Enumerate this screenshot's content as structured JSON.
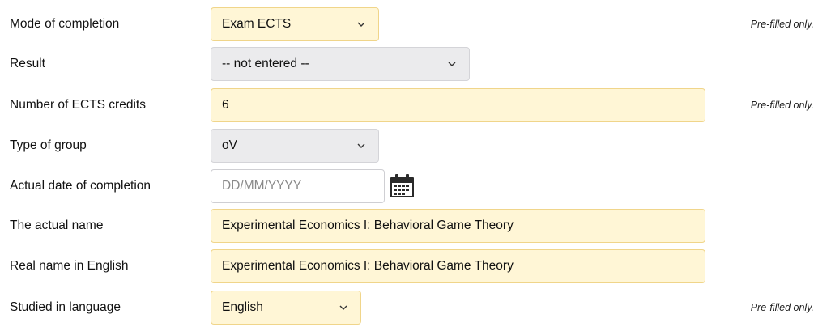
{
  "rows": {
    "mode": {
      "label": "Mode of completion",
      "value": "Exam ECTS",
      "note": "Pre-filled only."
    },
    "result": {
      "label": "Result",
      "value": "-- not entered --"
    },
    "credits": {
      "label": "Number of ECTS credits",
      "value": "6",
      "note": "Pre-filled only."
    },
    "group": {
      "label": "Type of group",
      "value": "oV"
    },
    "date": {
      "label": "Actual date of completion",
      "placeholder": "DD/MM/YYYY",
      "icon": "calendar-icon"
    },
    "actual_name": {
      "label": "The actual name",
      "value": "Experimental Economics I: Behavioral Game Theory"
    },
    "name_en": {
      "label": "Real name in English",
      "value": "Experimental Economics I: Behavioral Game Theory"
    },
    "language": {
      "label": "Studied in language",
      "value": "English",
      "note": "Pre-filled only."
    }
  },
  "colors": {
    "prefilled_bg": "#fff6d6",
    "prefilled_border": "#f0d58a",
    "plain_bg": "#ebebed"
  }
}
